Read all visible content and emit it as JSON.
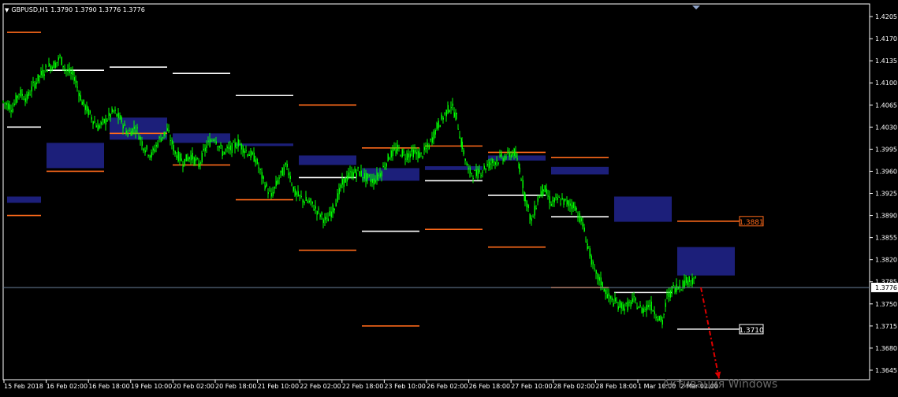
{
  "window": {
    "title": "GBPUSD,H1  1.3790 1.3790 1.3776 1.3776",
    "watermark": "Активация Windows"
  },
  "colors": {
    "background": "#000000",
    "candles": "#00ff00",
    "axis": "#ffffff",
    "zone_fill": "#1c1f7a",
    "level_orange": "#ff6a1a",
    "level_white": "#ffffff",
    "forecast_arrow": "#e00000",
    "price_line": "#6a7f9a"
  },
  "chart_data": {
    "type": "candlestick",
    "symbol": "GBPUSD",
    "timeframe": "H1",
    "ohlc_header": {
      "open": 1.379,
      "high": 1.379,
      "low": 1.3776,
      "close": 1.3776
    },
    "ylim": [
      1.363,
      1.4225
    ],
    "y_ticks": [
      "1.4205",
      "1.4170",
      "1.4135",
      "1.4100",
      "1.4065",
      "1.4030",
      "1.3995",
      "1.3960",
      "1.3925",
      "1.3890",
      "1.3855",
      "1.3820",
      "1.3785",
      "1.3750",
      "1.3715",
      "1.3680",
      "1.3645"
    ],
    "x_labels": [
      "15 Feb 2018",
      "16 Feb 02:00",
      "16 Feb 18:00",
      "19 Feb 10:00",
      "20 Feb 02:00",
      "20 Feb 18:00",
      "21 Feb 10:00",
      "22 Feb 02:00",
      "22 Feb 18:00",
      "23 Feb 10:00",
      "26 Feb 02:00",
      "26 Feb 18:00",
      "27 Feb 10:00",
      "28 Feb 02:00",
      "28 Feb 18:00",
      "1 Mar 10:00",
      "2 Mar 02:00"
    ],
    "price_path": [
      [
        0,
        1.407
      ],
      [
        12,
        1.406
      ],
      [
        20,
        1.4085
      ],
      [
        30,
        1.4075
      ],
      [
        38,
        1.4095
      ],
      [
        46,
        1.411
      ],
      [
        56,
        1.4125
      ],
      [
        66,
        1.413
      ],
      [
        72,
        1.414
      ],
      [
        80,
        1.412
      ],
      [
        90,
        1.411
      ],
      [
        100,
        1.407
      ],
      [
        110,
        1.405
      ],
      [
        120,
        1.403
      ],
      [
        130,
        1.404
      ],
      [
        140,
        1.4055
      ],
      [
        150,
        1.404
      ],
      [
        158,
        1.402
      ],
      [
        168,
        1.403
      ],
      [
        178,
        1.4
      ],
      [
        188,
        1.3985
      ],
      [
        198,
        1.401
      ],
      [
        208,
        1.4025
      ],
      [
        218,
        1.399
      ],
      [
        228,
        1.3975
      ],
      [
        238,
        1.3985
      ],
      [
        248,
        1.397
      ],
      [
        258,
        1.4
      ],
      [
        268,
        1.4015
      ],
      [
        278,
        1.399
      ],
      [
        288,
        1.3995
      ],
      [
        298,
        1.4005
      ],
      [
        310,
        1.399
      ],
      [
        320,
        1.398
      ],
      [
        330,
        1.3945
      ],
      [
        340,
        1.392
      ],
      [
        350,
        1.395
      ],
      [
        360,
        1.397
      ],
      [
        370,
        1.3925
      ],
      [
        380,
        1.3915
      ],
      [
        390,
        1.391
      ],
      [
        400,
        1.3895
      ],
      [
        410,
        1.388
      ],
      [
        420,
        1.3905
      ],
      [
        430,
        1.394
      ],
      [
        440,
        1.3955
      ],
      [
        450,
        1.396
      ],
      [
        460,
        1.395
      ],
      [
        470,
        1.3945
      ],
      [
        480,
        1.396
      ],
      [
        490,
        1.3985
      ],
      [
        500,
        1.3995
      ],
      [
        510,
        1.3985
      ],
      [
        520,
        1.399
      ],
      [
        530,
        1.3985
      ],
      [
        540,
        1.4
      ],
      [
        550,
        1.403
      ],
      [
        560,
        1.405
      ],
      [
        568,
        1.4065
      ],
      [
        575,
        1.4045
      ],
      [
        582,
        1.4
      ],
      [
        590,
        1.396
      ],
      [
        600,
        1.3955
      ],
      [
        610,
        1.3965
      ],
      [
        620,
        1.3975
      ],
      [
        630,
        1.398
      ],
      [
        640,
        1.3985
      ],
      [
        648,
        1.399
      ],
      [
        655,
        1.3965
      ],
      [
        662,
        1.392
      ],
      [
        670,
        1.388
      ],
      [
        678,
        1.3915
      ],
      [
        685,
        1.3935
      ],
      [
        695,
        1.391
      ],
      [
        705,
        1.3915
      ],
      [
        715,
        1.391
      ],
      [
        725,
        1.3905
      ],
      [
        735,
        1.3875
      ],
      [
        742,
        1.384
      ],
      [
        750,
        1.38
      ],
      [
        758,
        1.3785
      ],
      [
        768,
        1.376
      ],
      [
        778,
        1.375
      ],
      [
        790,
        1.3745
      ],
      [
        800,
        1.3755
      ],
      [
        810,
        1.374
      ],
      [
        820,
        1.375
      ],
      [
        828,
        1.3735
      ],
      [
        836,
        1.372
      ],
      [
        842,
        1.376
      ],
      [
        850,
        1.3775
      ],
      [
        860,
        1.378
      ],
      [
        870,
        1.379
      ],
      [
        880,
        1.3785
      ]
    ],
    "zones": [
      {
        "x0": 5,
        "x1": 48,
        "y_high": 1.392,
        "y_low": 1.391
      },
      {
        "x0": 55,
        "x1": 128,
        "y_high": 1.4005,
        "y_low": 1.3965
      },
      {
        "x0": 135,
        "x1": 208,
        "y_high": 1.4045,
        "y_low": 1.401
      },
      {
        "x0": 215,
        "x1": 288,
        "y_high": 1.402,
        "y_low": 1.4005
      },
      {
        "x0": 295,
        "x1": 368,
        "y_high": 1.4004,
        "y_low": 1.4
      },
      {
        "x0": 375,
        "x1": 448,
        "y_high": 1.3985,
        "y_low": 1.397
      },
      {
        "x0": 455,
        "x1": 528,
        "y_high": 1.3965,
        "y_low": 1.3945
      },
      {
        "x0": 535,
        "x1": 608,
        "y_high": 1.3968,
        "y_low": 1.3962
      },
      {
        "x0": 615,
        "x1": 688,
        "y_high": 1.3985,
        "y_low": 1.3977
      },
      {
        "x0": 695,
        "x1": 768,
        "y_high": 1.3967,
        "y_low": 1.3955
      },
      {
        "x0": 775,
        "x1": 848,
        "y_high": 1.392,
        "y_low": 1.388
      },
      {
        "x0": 855,
        "x1": 928,
        "y_high": 1.384,
        "y_low": 1.3795
      }
    ],
    "levels": [
      {
        "x0": 5,
        "x1": 48,
        "y": 1.418,
        "color": "orange"
      },
      {
        "x0": 5,
        "x1": 48,
        "y": 1.403,
        "color": "white"
      },
      {
        "x0": 5,
        "x1": 48,
        "y": 1.389,
        "color": "orange"
      },
      {
        "x0": 55,
        "x1": 128,
        "y": 1.412,
        "color": "white"
      },
      {
        "x0": 55,
        "x1": 128,
        "y": 1.396,
        "color": "orange"
      },
      {
        "x0": 135,
        "x1": 208,
        "y": 1.4125,
        "color": "white"
      },
      {
        "x0": 135,
        "x1": 208,
        "y": 1.402,
        "color": "orange"
      },
      {
        "x0": 215,
        "x1": 288,
        "y": 1.4115,
        "color": "white"
      },
      {
        "x0": 215,
        "x1": 288,
        "y": 1.397,
        "color": "orange"
      },
      {
        "x0": 295,
        "x1": 368,
        "y": 1.408,
        "color": "white"
      },
      {
        "x0": 295,
        "x1": 368,
        "y": 1.3915,
        "color": "orange"
      },
      {
        "x0": 375,
        "x1": 448,
        "y": 1.4065,
        "color": "orange"
      },
      {
        "x0": 375,
        "x1": 448,
        "y": 1.395,
        "color": "white"
      },
      {
        "x0": 375,
        "x1": 448,
        "y": 1.3835,
        "color": "orange"
      },
      {
        "x0": 455,
        "x1": 528,
        "y": 1.3997,
        "color": "orange"
      },
      {
        "x0": 455,
        "x1": 528,
        "y": 1.3865,
        "color": "white"
      },
      {
        "x0": 455,
        "x1": 528,
        "y": 1.3715,
        "color": "orange"
      },
      {
        "x0": 535,
        "x1": 608,
        "y": 1.4,
        "color": "orange"
      },
      {
        "x0": 535,
        "x1": 608,
        "y": 1.3945,
        "color": "white"
      },
      {
        "x0": 535,
        "x1": 608,
        "y": 1.3868,
        "color": "orange"
      },
      {
        "x0": 615,
        "x1": 688,
        "y": 1.399,
        "color": "orange"
      },
      {
        "x0": 615,
        "x1": 688,
        "y": 1.3922,
        "color": "white"
      },
      {
        "x0": 615,
        "x1": 688,
        "y": 1.384,
        "color": "orange"
      },
      {
        "x0": 695,
        "x1": 768,
        "y": 1.3982,
        "color": "orange"
      },
      {
        "x0": 695,
        "x1": 768,
        "y": 1.3888,
        "color": "white"
      },
      {
        "x0": 695,
        "x1": 768,
        "y": 1.3776,
        "color": "orange"
      },
      {
        "x0": 775,
        "x1": 848,
        "y": 1.3768,
        "color": "white"
      },
      {
        "x0": 855,
        "x1": 935,
        "y": 1.3881,
        "color": "orange"
      },
      {
        "x0": 855,
        "x1": 935,
        "y": 1.371,
        "color": "white"
      }
    ],
    "current_price": {
      "value": 1.3776,
      "label": "1.3776"
    },
    "level_labels": [
      {
        "value": 1.3881,
        "label": "1.3881",
        "color": "orange"
      },
      {
        "value": 1.371,
        "label": "1.3710",
        "color": "white"
      }
    ],
    "forecast_arrow": {
      "from": [
        885,
        1.3776
      ],
      "to": [
        908,
        1.3632
      ]
    }
  }
}
